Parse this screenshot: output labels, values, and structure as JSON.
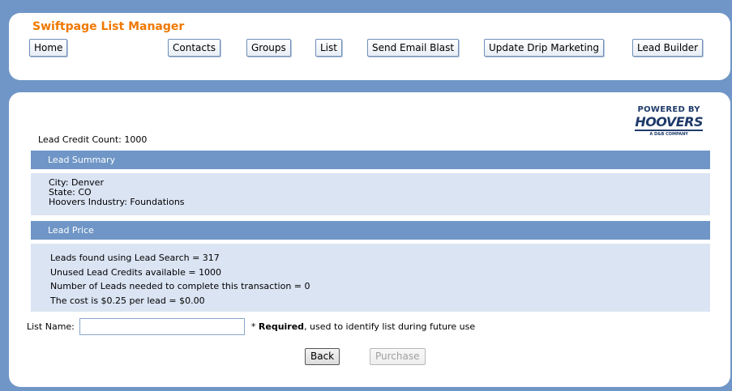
{
  "header": {
    "title": "Swiftpage List Manager",
    "nav": [
      {
        "label": "Home"
      },
      {
        "label": "Contacts"
      },
      {
        "label": "Groups"
      },
      {
        "label": "List"
      },
      {
        "label": "Send Email Blast"
      },
      {
        "label": "Update Drip Marketing"
      },
      {
        "label": "Lead Builder"
      }
    ]
  },
  "branding": {
    "powered_by": "POWERED BY",
    "logo": "HOOVERS",
    "tagline": "A D&B COMPANY"
  },
  "lead_credit_count": "Lead Credit Count: 1000",
  "lead_summary": {
    "heading": "Lead Summary",
    "lines": [
      "City: Denver",
      "State: CO",
      "Hoovers Industry: Foundations"
    ]
  },
  "lead_price": {
    "heading": "Lead Price",
    "lines": [
      "Leads found using Lead Search = 317",
      "Unused Lead Credits available = 1000",
      "Number of Leads needed to complete this transaction = 0",
      "The cost is $0.25 per lead = $0.00"
    ]
  },
  "list_name": {
    "label": "List Name:",
    "value": "",
    "required_prefix": "* ",
    "required_word": "Required",
    "required_rest": ", used to identify list during future use"
  },
  "buttons": {
    "back": "Back",
    "purchase": "Purchase"
  },
  "colors": {
    "accent_orange": "#f07800",
    "frame_blue": "#6f96c6",
    "box_blue": "#dbe4f3"
  }
}
